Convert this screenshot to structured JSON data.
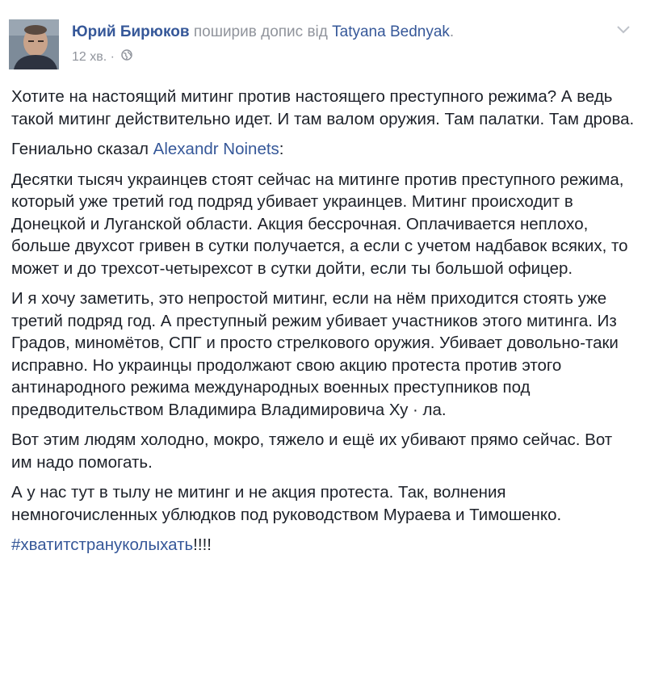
{
  "post": {
    "author_name": "Юрий Бирюков",
    "shared_text": " поширив допис від ",
    "origin_name": "Tatyana Bednyak",
    "origin_suffix": ".",
    "timestamp": "12 хв.",
    "meta_sep": " · ",
    "privacy_icon": "globe-icon",
    "menu_icon": "chevron-down-icon",
    "paragraphs": {
      "p1": "Хотите на настоящий митинг против настоящего преступного режима? А ведь такой митинг действительно идет. И там валом оружия. Там палатки. Там дрова.",
      "p2_prefix": "Гениально сказал ",
      "p2_link": "Alexandr Noinets",
      "p2_suffix": ":",
      "p3": "Десятки тысяч украинцев стоят сейчас на митинге против преступного режима, который уже третий год подряд убивает украинцев. Митинг происходит в Донецкой и Луганской области. Акция бессрочная. Оплачивается неплохо, больше двухсот гривен в сутки получается, а если с учетом надбавок всяких, то может и до трехсот-четырехсот в сутки дойти, если ты большой офицер.",
      "p4": "И я хочу заметить, это непростой митинг, если на нём приходится стоять уже третий подряд год. А преступный режим убивает участников этого митинга. Из Градов, миномётов, СПГ и просто стрелкового оружия. Убивает довольно-таки исправно. Но украинцы продолжают свою акцию протеста против этого антинародного режима международных военных преступников под предводительством Владимира Владимировича Ху · ла.",
      "p5": "Вот этим людям холодно, мокро, тяжело и ещё их убивают прямо сейчас. Вот им надо помогать.",
      "p6": "А у нас тут в тылу не митинг и не акция протеста. Так, волнения немногочисленных ублюдков под руководством Мураева и Тимошенко.",
      "hashtag": "#хватитстрануколыхать",
      "hashtag_suffix": "!!!!"
    },
    "colors": {
      "link": "#365899",
      "meta": "#90949c",
      "text": "#1d2129"
    }
  }
}
